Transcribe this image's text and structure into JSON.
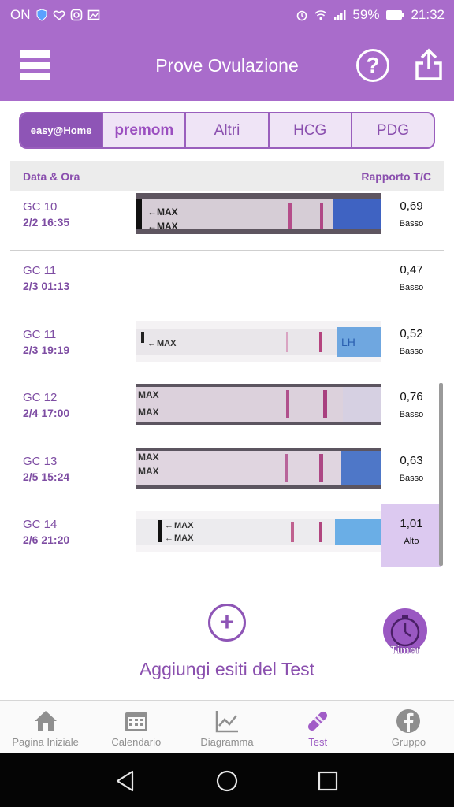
{
  "status_bar": {
    "carrier": "ON",
    "battery": "59%",
    "time": "21:32"
  },
  "app_bar": {
    "title": "Prove Ovulazione",
    "menu_icon": "hamburger-icon",
    "help_icon": "question-circle-icon",
    "share_icon": "share-upload-icon"
  },
  "brand_tabs": [
    {
      "label": "easy@Home",
      "active": true
    },
    {
      "label": "premom",
      "active": false
    },
    {
      "label": "Altri",
      "active": false
    },
    {
      "label": "HCG",
      "active": false
    },
    {
      "label": "PDG",
      "active": false
    }
  ],
  "table": {
    "col_date": "Data & Ora",
    "col_ratio": "Rapporto T/C",
    "rows": [
      {
        "name": "GC 10",
        "datetime": "2/2   16:35",
        "ratio": "0,69",
        "level": "Basso",
        "has_strip": true
      },
      {
        "name": "GC 11",
        "datetime": "2/3   01:13",
        "ratio": "0,47",
        "level": "Basso",
        "has_strip": false
      },
      {
        "name": "GC 11",
        "datetime": "2/3   19:19",
        "ratio": "0,52",
        "level": "Basso",
        "has_strip": true
      },
      {
        "name": "GC 12",
        "datetime": "2/4   17:00",
        "ratio": "0,76",
        "level": "Basso",
        "has_strip": true
      },
      {
        "name": "GC 13",
        "datetime": "2/5   15:24",
        "ratio": "0,63",
        "level": "Basso",
        "has_strip": true
      },
      {
        "name": "GC 14",
        "datetime": "2/6   21:20",
        "ratio": "1,01",
        "level": "Alto",
        "has_strip": true
      }
    ]
  },
  "strip_text": {
    "max": "MAX",
    "lh": "LH"
  },
  "add_results": {
    "label": "Aggiungi esiti del Test",
    "icon": "plus-circle-icon"
  },
  "timer": {
    "label": "Timer",
    "icon": "stopwatch-icon"
  },
  "bottom_nav": [
    {
      "label": "Pagina Iniziale",
      "icon": "home-icon",
      "active": false
    },
    {
      "label": "Calendario",
      "icon": "calendar-icon",
      "active": false
    },
    {
      "label": "Diagramma",
      "icon": "chart-line-icon",
      "active": false
    },
    {
      "label": "Test",
      "icon": "test-strip-icon",
      "active": true
    },
    {
      "label": "Gruppo",
      "icon": "facebook-icon",
      "active": false
    }
  ],
  "colors": {
    "primary": "#a96ccb",
    "accent": "#8e55b6",
    "high_level_bg": "#dcc9f0"
  }
}
